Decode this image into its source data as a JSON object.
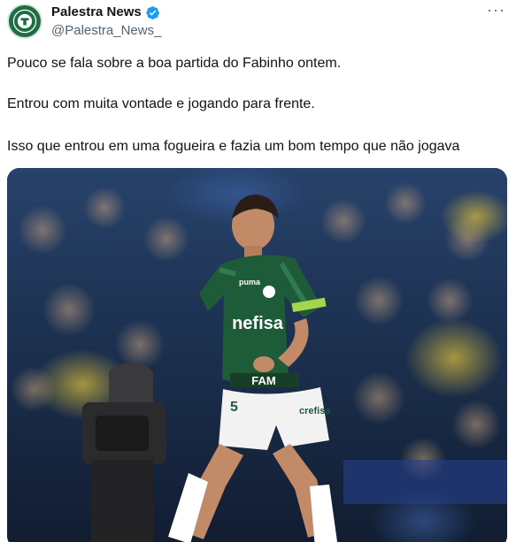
{
  "account": {
    "display_name": "Palestra News",
    "handle": "@Palestra_News_",
    "avatar_icon": "palestra-logo-icon",
    "verified_icon": "verified-badge-icon",
    "verified_color": "#1d9bf0"
  },
  "menu": {
    "more_label": "···"
  },
  "post": {
    "paragraphs": [
      "Pouco se fala sobre a boa partida do Fabinho ontem.",
      "Entrou com muita vontade e jogando para frente.",
      "Isso que entrou em uma fogueira e fazia um bom tempo que não jogava"
    ]
  },
  "media": {
    "kind": "photo",
    "jersey_sponsor": "nefisa",
    "jersey_brand": "puma",
    "shirt_band": "FAM",
    "shorts_number": "5",
    "shorts_sponsor": "crefisa",
    "kit_colors": {
      "shirt": "#1e5b39",
      "shorts": "#f2f2f2",
      "accent": "#a7d34d"
    }
  }
}
